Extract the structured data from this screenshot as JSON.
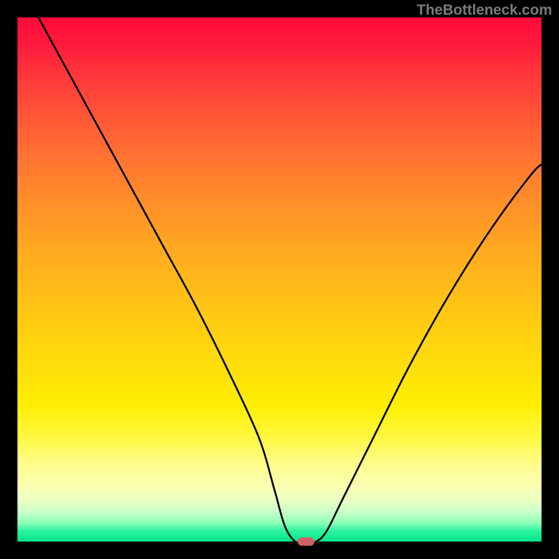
{
  "watermark": "TheBottleneck.com",
  "chart_data": {
    "type": "line",
    "title": "",
    "xlabel": "",
    "ylabel": "",
    "xlim": [
      0,
      100
    ],
    "ylim": [
      0,
      100
    ],
    "grid": false,
    "background": "red-yellow-green vertical gradient",
    "series": [
      {
        "name": "bottleneck-curve",
        "color": "#000000",
        "x": [
          4,
          10,
          16,
          22,
          28,
          34,
          40,
          46,
          49,
          51,
          53,
          55,
          57,
          59,
          62,
          68,
          74,
          80,
          86,
          92,
          98,
          100
        ],
        "y": [
          100,
          89,
          78,
          67,
          56,
          45,
          33,
          20,
          10,
          3,
          0,
          0,
          0,
          2,
          8,
          20,
          32,
          43,
          53,
          62,
          70,
          72
        ]
      }
    ],
    "marker": {
      "name": "optimal-point",
      "color": "#d16065",
      "x": 55,
      "y": 0,
      "width_pct": 3.2,
      "height_pct": 1.6
    }
  }
}
